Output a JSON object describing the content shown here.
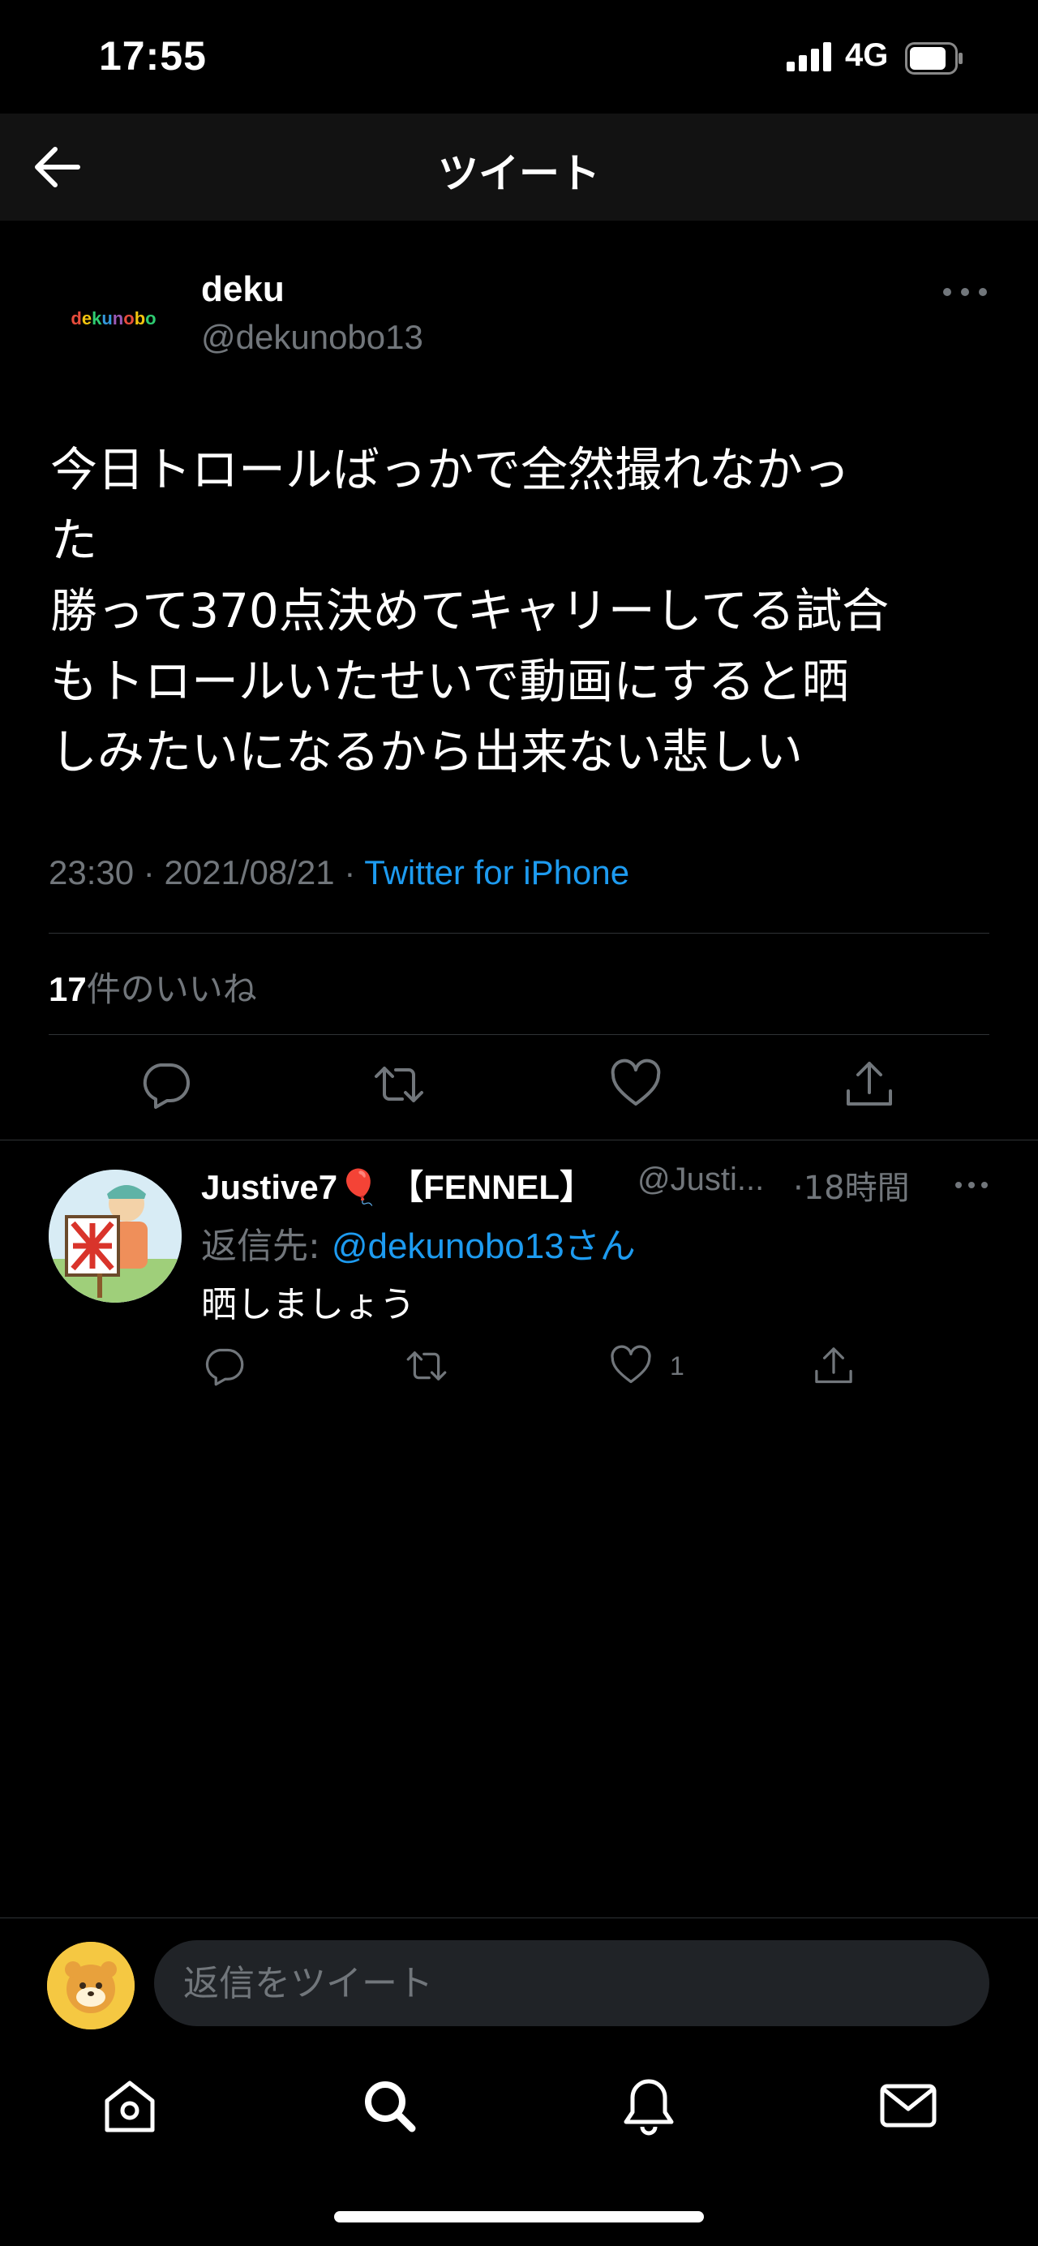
{
  "status_bar": {
    "time": "17:55",
    "network": "4G"
  },
  "header": {
    "title": "ツイート"
  },
  "tweet": {
    "author": {
      "name": "deku",
      "handle": "@dekunobo13",
      "logo_text": "dekunobo"
    },
    "text": "今日トロールばっかで全然撮れなかっ\nた\n勝って370点決めてキャリーしてる試合\nもトロールいたせいで動画にすると晒\nしみたいになるから出来ない悲しい",
    "time": "23:30",
    "date": "2021/08/21",
    "separator": " · ",
    "source": "Twitter for iPhone",
    "likes_count": "17",
    "likes_label": "件のいいね"
  },
  "reply": {
    "name": "Justive7🎈 【FENNEL】",
    "handle": "@Justi...",
    "time": "·18時間",
    "reply_to_label": "返信先: ",
    "reply_to_mention": "@dekunobo13さん",
    "text": "晒しましょう",
    "like_count": "1"
  },
  "compose": {
    "placeholder": "返信をツイート"
  },
  "colors": {
    "background": "#000000",
    "accent": "#1d9bf0",
    "muted": "#71767b",
    "divider": "#2f3336"
  },
  "icons": {
    "back": "back-arrow-icon",
    "more": "more-dots-icon",
    "reply": "reply-bubble-icon",
    "retweet": "retweet-icon",
    "like": "heart-icon",
    "share": "share-icon",
    "home": "home-icon",
    "search": "search-icon",
    "notifications": "bell-icon",
    "messages": "mail-icon"
  }
}
